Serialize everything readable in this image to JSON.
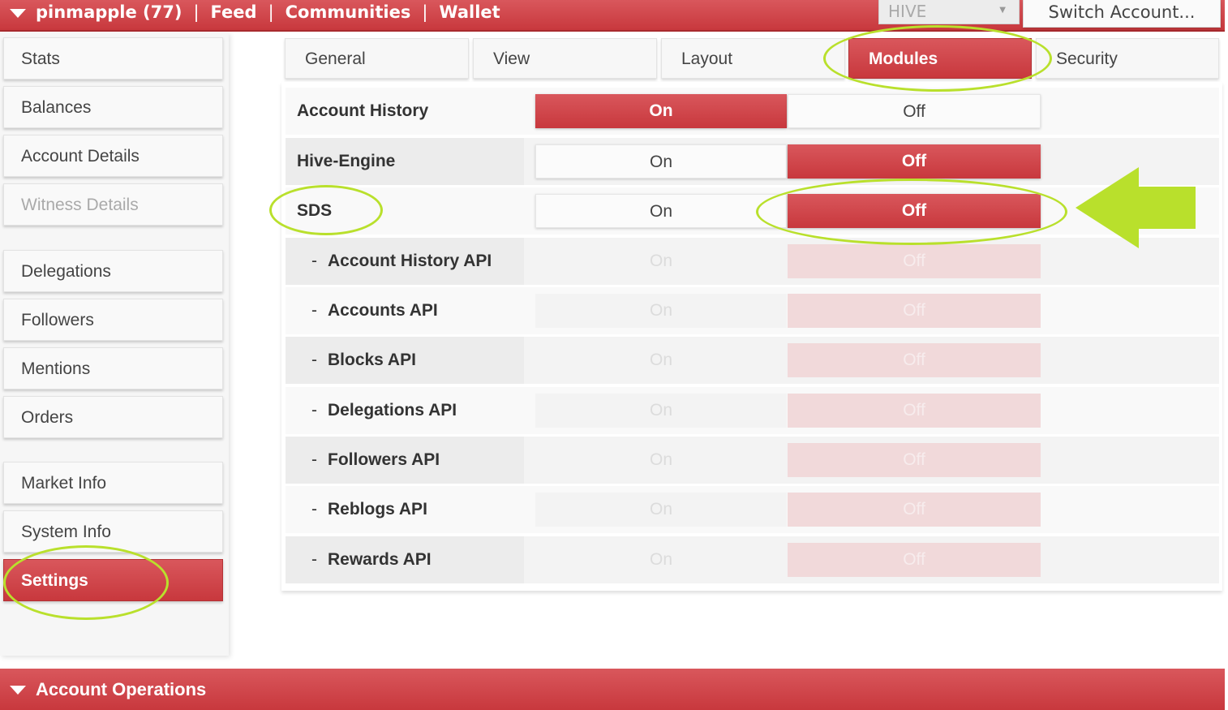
{
  "topbar": {
    "account": "pinmapple (77)",
    "nav": [
      "Feed",
      "Communities",
      "Wallet"
    ],
    "separator": "|",
    "chain_select": "HIVE",
    "switch_account": "Switch Account..."
  },
  "sidebar": {
    "items": [
      {
        "label": "Stats",
        "state": "normal"
      },
      {
        "label": "Balances",
        "state": "normal"
      },
      {
        "label": "Account Details",
        "state": "normal"
      },
      {
        "label": "Witness Details",
        "state": "disabled"
      },
      {
        "label": "Delegations",
        "state": "normal"
      },
      {
        "label": "Followers",
        "state": "normal"
      },
      {
        "label": "Mentions",
        "state": "normal"
      },
      {
        "label": "Orders",
        "state": "normal"
      },
      {
        "label": "Market Info",
        "state": "normal"
      },
      {
        "label": "System Info",
        "state": "normal"
      },
      {
        "label": "Settings",
        "state": "active"
      }
    ]
  },
  "tabs": [
    {
      "label": "General",
      "active": false
    },
    {
      "label": "View",
      "active": false
    },
    {
      "label": "Layout",
      "active": false
    },
    {
      "label": "Modules",
      "active": true
    },
    {
      "label": "Security",
      "active": false
    }
  ],
  "toggle_labels": {
    "on": "On",
    "off": "Off"
  },
  "modules": [
    {
      "label": "Account History",
      "value": "on",
      "sub": false,
      "disabled": false
    },
    {
      "label": "Hive-Engine",
      "value": "off",
      "sub": false,
      "disabled": false
    },
    {
      "label": "SDS",
      "value": "off",
      "sub": false,
      "disabled": false
    },
    {
      "label": "Account History API",
      "value": "off",
      "sub": true,
      "disabled": true
    },
    {
      "label": "Accounts API",
      "value": "off",
      "sub": true,
      "disabled": true
    },
    {
      "label": "Blocks API",
      "value": "off",
      "sub": true,
      "disabled": true
    },
    {
      "label": "Delegations API",
      "value": "off",
      "sub": true,
      "disabled": true
    },
    {
      "label": "Followers API",
      "value": "off",
      "sub": true,
      "disabled": true
    },
    {
      "label": "Reblogs API",
      "value": "off",
      "sub": true,
      "disabled": true
    },
    {
      "label": "Rewards API",
      "value": "off",
      "sub": true,
      "disabled": true
    }
  ],
  "sub_prefix": "-",
  "bottombar": {
    "label": "Account Operations"
  },
  "colors": {
    "accent": "#c8383d",
    "highlight": "#b9e02c"
  }
}
